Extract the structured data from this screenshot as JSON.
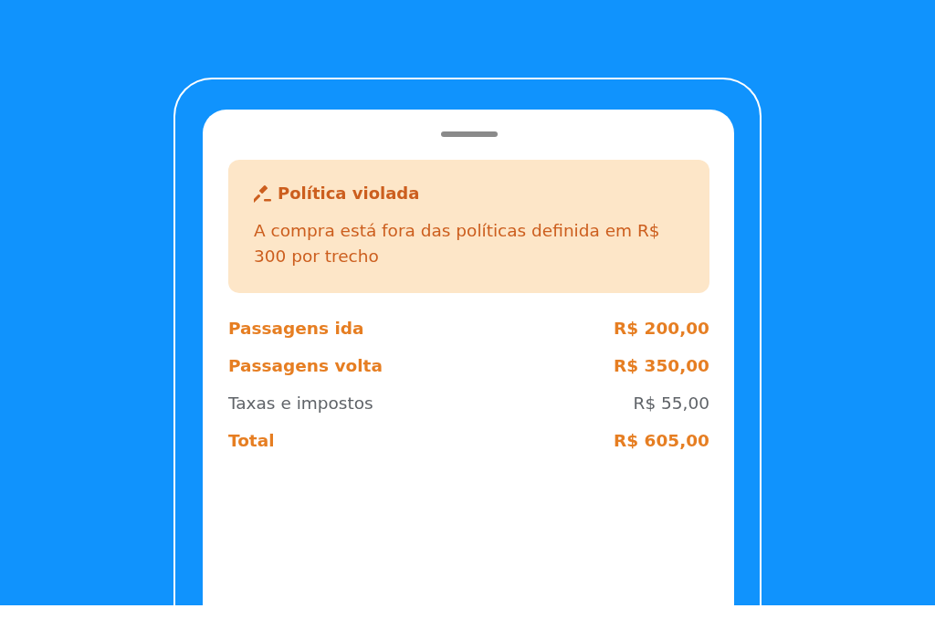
{
  "alert": {
    "title": "Política violada",
    "message": "A compra está fora das políticas definida em R$ 300 por trecho"
  },
  "rows": [
    {
      "label": "Passagens ida",
      "value": "R$ 200,00",
      "kind": "highlight"
    },
    {
      "label": "Passagens volta",
      "value": "R$ 350,00",
      "kind": "highlight"
    },
    {
      "label": "Taxas e impostos",
      "value": "R$ 55,00",
      "kind": "normal"
    },
    {
      "label": "Total",
      "value": "R$ 605,00",
      "kind": "highlight"
    }
  ]
}
